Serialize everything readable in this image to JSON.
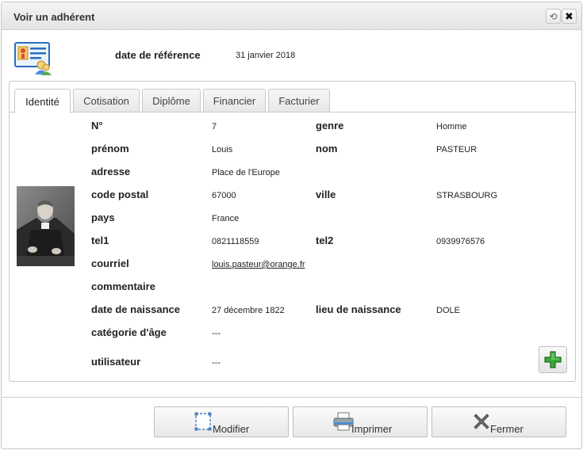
{
  "window": {
    "title": "Voir un adhérent",
    "refresh_glyph": "⟲",
    "close_glyph": "✖"
  },
  "header": {
    "icon": "member-card-icon",
    "ref_date_label": "date de référence",
    "ref_date_value": "31 janvier 2018"
  },
  "tabs": [
    {
      "label": "Identité",
      "active": true
    },
    {
      "label": "Cotisation",
      "active": false
    },
    {
      "label": "Diplôme",
      "active": false
    },
    {
      "label": "Financier",
      "active": false
    },
    {
      "label": "Facturier",
      "active": false
    }
  ],
  "identity": {
    "photo": "member-portrait",
    "num_label": "N°",
    "num_value": "7",
    "genre_label": "genre",
    "genre_value": "Homme",
    "prenom_label": "prénom",
    "prenom_value": "Louis",
    "nom_label": "nom",
    "nom_value": "PASTEUR",
    "adresse_label": "adresse",
    "adresse_value": "Place de l'Europe",
    "cp_label": "code postal",
    "cp_value": "67000",
    "ville_label": "ville",
    "ville_value": "STRASBOURG",
    "pays_label": "pays",
    "pays_value": "France",
    "tel1_label": "tel1",
    "tel1_value": "0821118559",
    "tel2_label": "tel2",
    "tel2_value": "0939976576",
    "courriel_label": "courriel",
    "courriel_value": "louis.pasteur@orange.fr",
    "commentaire_label": "commentaire",
    "naissance_label": "date de naissance",
    "naissance_value": "27 décembre 1822",
    "lieu_label": "lieu de naissance",
    "lieu_value": "DOLE",
    "categorie_label": "catégorie d'âge",
    "categorie_value": "---",
    "utilisateur_label": "utilisateur",
    "utilisateur_value": "---"
  },
  "add_button": {
    "icon": "green-plus-icon"
  },
  "footer": {
    "modify_label": "Modifier",
    "print_label": "Imprimer",
    "close_label": "Fermer"
  },
  "colors": {
    "plus_green": "#3aa83a",
    "icon_blue": "#2a6ebf"
  }
}
